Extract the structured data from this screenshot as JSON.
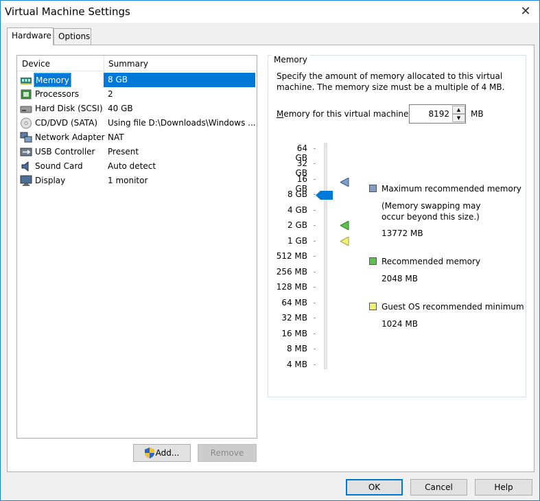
{
  "window": {
    "title": "Virtual Machine Settings"
  },
  "tabs": [
    {
      "label": "Hardware"
    },
    {
      "label": "Options"
    }
  ],
  "device_list": {
    "headers": {
      "device": "Device",
      "summary": "Summary"
    },
    "rows": [
      {
        "device": "Memory",
        "summary": "8 GB",
        "icon": "memory-icon",
        "selected": true
      },
      {
        "device": "Processors",
        "summary": "2",
        "icon": "processor-icon"
      },
      {
        "device": "Hard Disk (SCSI)",
        "summary": "40 GB",
        "icon": "hard-disk-icon"
      },
      {
        "device": "CD/DVD (SATA)",
        "summary": "Using file D:\\Downloads\\Windows ...",
        "icon": "cd-dvd-icon"
      },
      {
        "device": "Network Adapter",
        "summary": "NAT",
        "icon": "network-adapter-icon"
      },
      {
        "device": "USB Controller",
        "summary": "Present",
        "icon": "usb-icon"
      },
      {
        "device": "Sound Card",
        "summary": "Auto detect",
        "icon": "sound-card-icon"
      },
      {
        "device": "Display",
        "summary": "1 monitor",
        "icon": "display-icon"
      }
    ]
  },
  "buttons": {
    "add": "Add...",
    "remove": "Remove",
    "ok": "OK",
    "cancel": "Cancel",
    "help": "Help"
  },
  "memory": {
    "group_title": "Memory",
    "description": "Specify the amount of memory allocated to this virtual machine. The memory size must be a multiple of 4 MB.",
    "field_label_prefix": "M",
    "field_label_rest": "emory for this virtual machine:",
    "value": "8192",
    "unit": "MB",
    "scale_labels": [
      "64 GB",
      "32 GB",
      "16 GB",
      "8 GB",
      "4 GB",
      "2 GB",
      "1 GB",
      "512 MB",
      "256 MB",
      "128 MB",
      "64 MB",
      "32 MB",
      "16 MB",
      "8 MB",
      "4 MB"
    ],
    "slider_value": "8 GB",
    "legend": {
      "max_title": "Maximum recommended memory",
      "max_note_1": "(Memory swapping may",
      "max_note_2": "occur beyond this size.)",
      "max_value": "13772 MB",
      "rec_title": "Recommended memory",
      "rec_value": "2048 MB",
      "min_title": "Guest OS recommended minimum",
      "min_value": "1024 MB"
    },
    "colors": {
      "max": "#7f9ec6",
      "rec": "#5fbf4f",
      "min": "#f3f07a",
      "thumb": "#0078d7"
    }
  }
}
